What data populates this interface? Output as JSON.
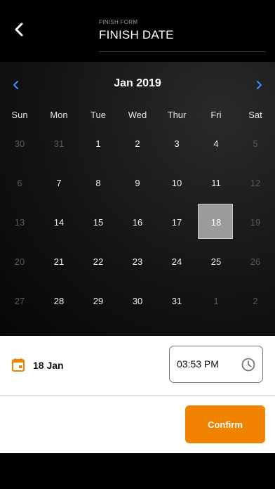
{
  "header": {
    "subtitle": "FINISH FORM",
    "title": "FINISH DATE"
  },
  "calendar": {
    "month_label": "Jan 2019",
    "weekdays": [
      "Sun",
      "Mon",
      "Tue",
      "Wed",
      "Thur",
      "Fri",
      "Sat"
    ],
    "weeks": [
      [
        {
          "d": "30",
          "m": true
        },
        {
          "d": "31",
          "m": true
        },
        {
          "d": "1"
        },
        {
          "d": "2"
        },
        {
          "d": "3"
        },
        {
          "d": "4"
        },
        {
          "d": "5",
          "m": true
        }
      ],
      [
        {
          "d": "6",
          "m": true
        },
        {
          "d": "7"
        },
        {
          "d": "8"
        },
        {
          "d": "9"
        },
        {
          "d": "10"
        },
        {
          "d": "11"
        },
        {
          "d": "12",
          "m": true
        }
      ],
      [
        {
          "d": "13",
          "m": true
        },
        {
          "d": "14"
        },
        {
          "d": "15"
        },
        {
          "d": "16"
        },
        {
          "d": "17"
        },
        {
          "d": "18",
          "s": true
        },
        {
          "d": "19",
          "m": true
        }
      ],
      [
        {
          "d": "20",
          "m": true
        },
        {
          "d": "21"
        },
        {
          "d": "22"
        },
        {
          "d": "23"
        },
        {
          "d": "24"
        },
        {
          "d": "25"
        },
        {
          "d": "26",
          "m": true
        }
      ],
      [
        {
          "d": "27",
          "m": true
        },
        {
          "d": "28"
        },
        {
          "d": "29"
        },
        {
          "d": "30"
        },
        {
          "d": "31"
        },
        {
          "d": "1",
          "m": true
        },
        {
          "d": "2",
          "m": true
        }
      ]
    ],
    "nav_color": "#3d8bff",
    "selected_color": "#9b9b9b"
  },
  "footer": {
    "date_icon": "calendar-icon",
    "date_label": "18 Jan",
    "time_value": "03:53 PM",
    "time_icon": "clock-icon",
    "confirm_label": "Confirm",
    "accent_color": "#f28300"
  }
}
